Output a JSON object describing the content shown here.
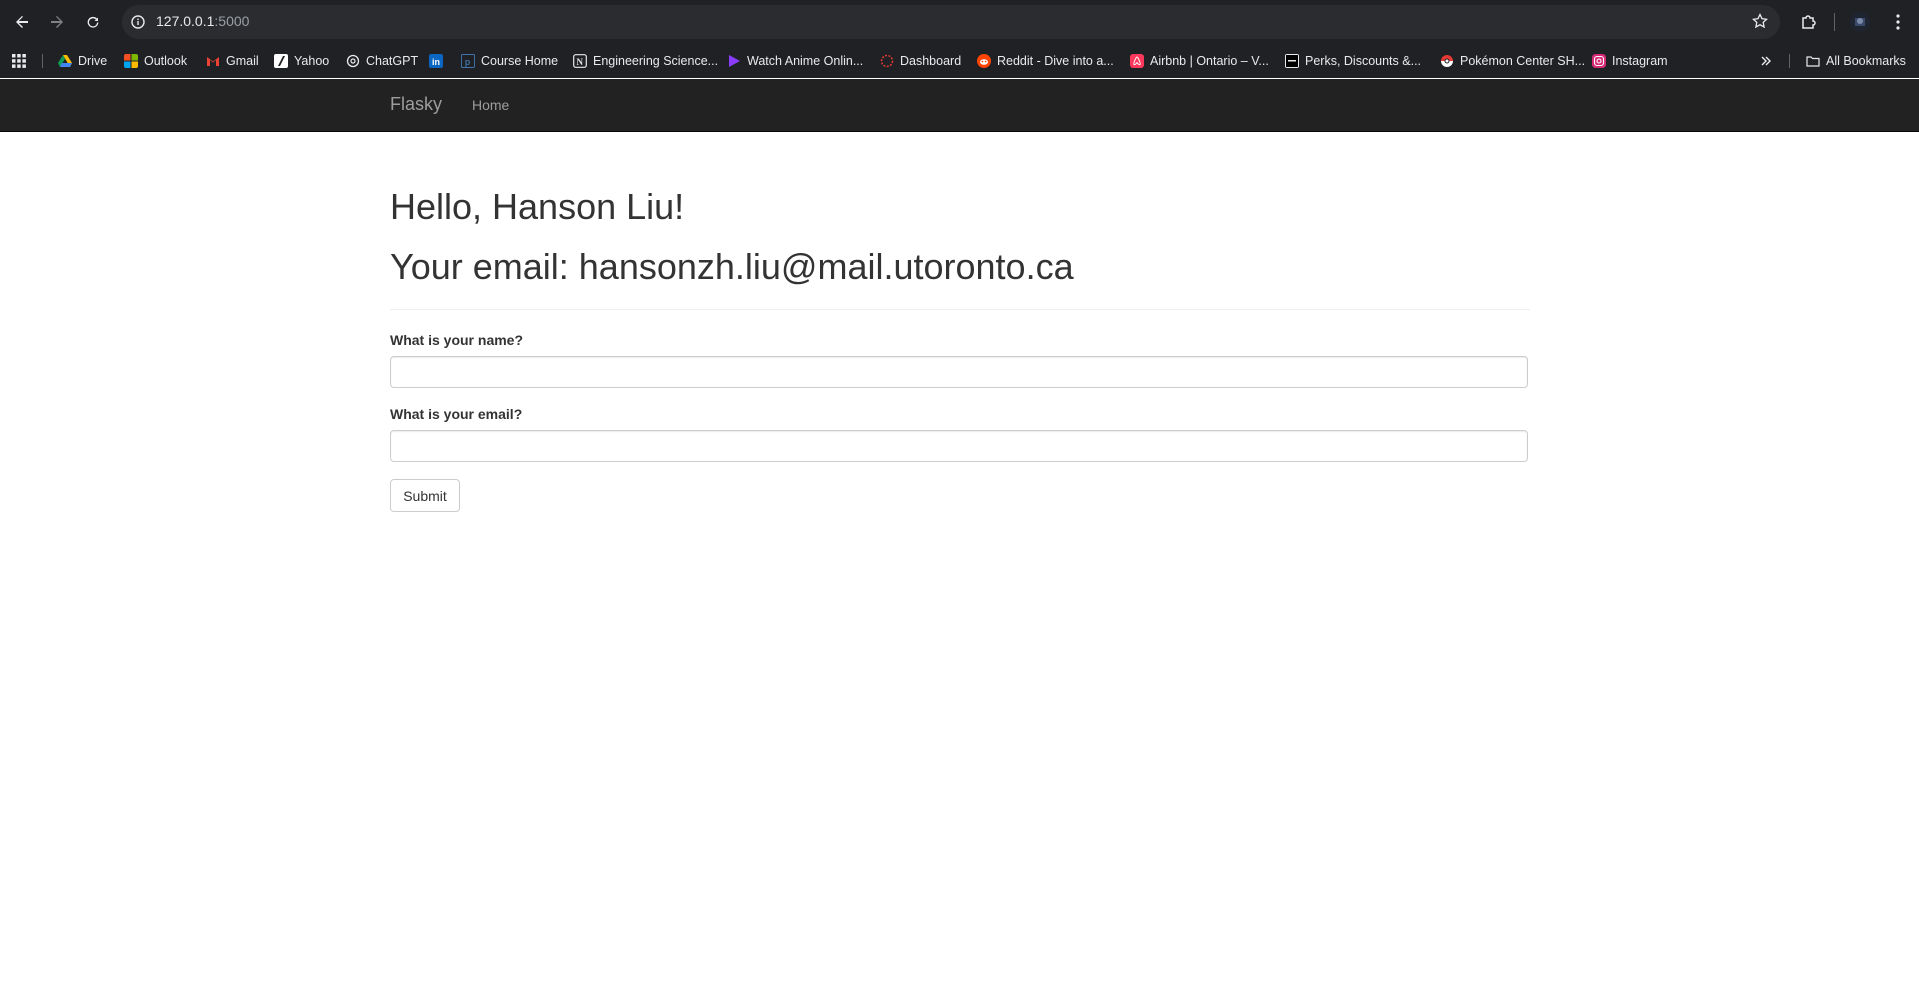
{
  "browser": {
    "url_host": "127.0.0.1",
    "url_port": ":5000",
    "bookmarks": [
      {
        "label": "Drive",
        "icon": "google-drive-icon",
        "color": "#34a853"
      },
      {
        "label": "Outlook",
        "icon": "microsoft-icon",
        "color": "#f25022"
      },
      {
        "label": "Gmail",
        "icon": "gmail-icon",
        "color": "#ea4335"
      },
      {
        "label": "Yahoo",
        "icon": "yahoo-icon",
        "color": "#ffffff"
      },
      {
        "label": "ChatGPT",
        "icon": "chatgpt-icon",
        "color": "#e8eaed"
      },
      {
        "label": "",
        "icon": "linkedin-icon",
        "color": "#0a66c2"
      },
      {
        "label": "Course Home",
        "icon": "course-icon",
        "color": "#4a90d9"
      },
      {
        "label": "Engineering Science...",
        "icon": "notion-icon",
        "color": "#e8eaed"
      },
      {
        "label": "Watch Anime Onlin...",
        "icon": "play-icon",
        "color": "#8b3dff"
      },
      {
        "label": "Dashboard",
        "icon": "dashboard-icon",
        "color": "#e53935"
      },
      {
        "label": "Reddit - Dive into a...",
        "icon": "reddit-icon",
        "color": "#ff4500"
      },
      {
        "label": "Airbnb | Ontario – V...",
        "icon": "airbnb-icon",
        "color": "#ff385c"
      },
      {
        "label": "Perks, Discounts &...",
        "icon": "perks-icon",
        "color": "#000000"
      },
      {
        "label": "Pokémon Center SH...",
        "icon": "pokeball-icon",
        "color": "#e53935"
      },
      {
        "label": "Instagram",
        "icon": "instagram-icon",
        "color": "#d62976"
      }
    ],
    "all_bookmarks": "All Bookmarks"
  },
  "navbar": {
    "brand": "Flasky",
    "home": "Home"
  },
  "main": {
    "greeting": "Hello, Hanson Liu!",
    "email_line": "Your email: hansonzh.liu@mail.utoronto.ca"
  },
  "form": {
    "name_label": "What is your name?",
    "name_value": "",
    "email_label": "What is your email?",
    "email_value": "",
    "submit_label": "Submit"
  }
}
